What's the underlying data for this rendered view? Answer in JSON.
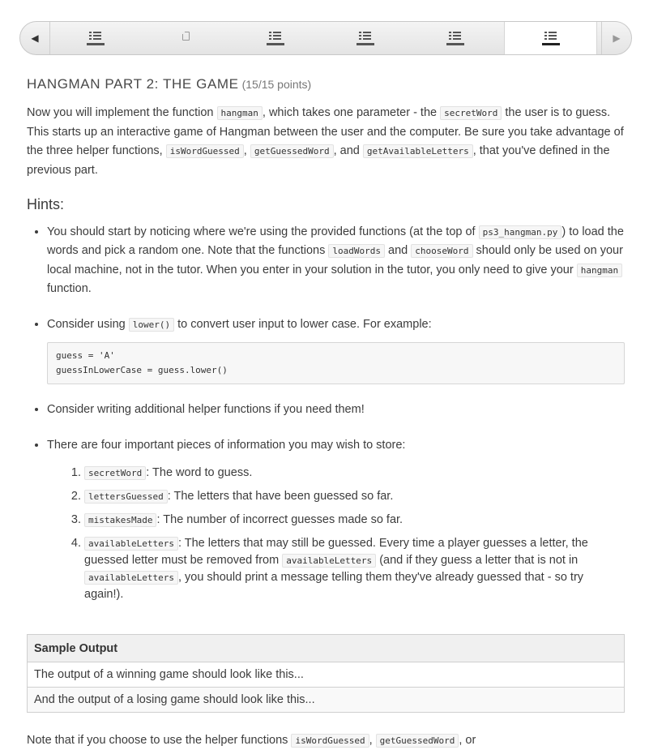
{
  "nav": {
    "prev_icon": "triangle-left-icon",
    "next_icon": "triangle-right-icon",
    "tabs": [
      {
        "icon": "list-icon",
        "active": false
      },
      {
        "icon": "page-icon",
        "active": false
      },
      {
        "icon": "list-icon",
        "active": false
      },
      {
        "icon": "list-icon",
        "active": false
      },
      {
        "icon": "list-icon",
        "active": false
      },
      {
        "icon": "list-icon",
        "active": true
      }
    ]
  },
  "problem": {
    "title": "HANGMAN PART 2: THE GAME",
    "points": "(15/15 points)"
  },
  "intro": {
    "t1": "Now you will implement the function ",
    "c1": "hangman",
    "t2": ", which takes one parameter - the ",
    "c2": "secretWord",
    "t3": " the user is to guess. This starts up an interactive game of Hangman between the user and the computer. Be sure you take advantage of the three helper functions, ",
    "c3": "isWordGuessed",
    "t4": ", ",
    "c4": "getGuessedWord",
    "t5": ", and ",
    "c5": "getAvailableLetters",
    "t6": ", that you've defined in the previous part."
  },
  "hints_heading": "Hints:",
  "hint1": {
    "t1": "You should start by noticing where we're using the provided functions (at the top of ",
    "c1": "ps3_hangman.py",
    "t2": ") to load the words and pick a random one. Note that the functions ",
    "c2": "loadWords",
    "t3": " and ",
    "c3": "chooseWord",
    "t4": " should only be used on your local machine, not in the tutor. When you enter in your solution in the tutor, you only need to give your ",
    "c4": "hangman",
    "t5": " function."
  },
  "hint2": {
    "t1": "Consider using ",
    "c1": "lower()",
    "t2": " to convert user input to lower case. For example:",
    "code": "guess = 'A'\nguessInLowerCase = guess.lower()"
  },
  "hint3": "Consider writing additional helper functions if you need them!",
  "hint4": {
    "text": "There are four important pieces of information you may wish to store:",
    "i1": {
      "code": "secretWord",
      "text": ": The word to guess."
    },
    "i2": {
      "code": "lettersGuessed",
      "text": ": The letters that have been guessed so far."
    },
    "i3": {
      "code": "mistakesMade",
      "text": ": The number of incorrect guesses made so far."
    },
    "i4": {
      "c1": "availableLetters",
      "t1": ": The letters that may still be guessed. Every time a player guesses a letter, the guessed letter must be removed from ",
      "c2": "availableLetters",
      "t2": " (and if they guess a letter that is not in ",
      "c3": "availableLetters",
      "t3": ", you should print a message telling them they've already guessed that - so try again!)."
    }
  },
  "sample": {
    "header": "Sample Output",
    "rows": [
      "The output of a winning game should look like this...",
      "And the output of a losing game should look like this..."
    ]
  },
  "note": {
    "t1": "Note that if you choose to use the helper functions ",
    "c1": "isWordGuessed",
    "t2": ", ",
    "c2": "getGuessedWord",
    "t3": ", or"
  }
}
